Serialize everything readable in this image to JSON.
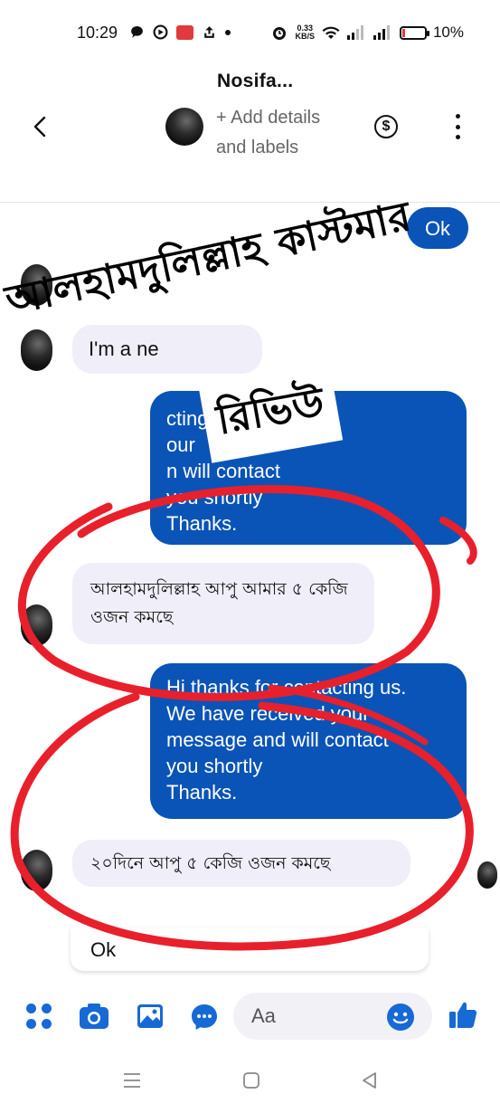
{
  "status_bar": {
    "time": "10:29",
    "net_speed_value": "0.33",
    "net_speed_unit": "KB/S",
    "battery": "10%"
  },
  "header": {
    "name": "Nosifa...",
    "subtitle": "+ Add details and labels",
    "payment_symbol": "$"
  },
  "messages": {
    "ok_out": "Ok",
    "incoming_1": "I'm a ne",
    "outgoing_1": "cting us.\nour\nn                 will contact\nyou shortly\nThanks.",
    "incoming_2": "আলহামদুলিল্লাহ আপু আমার ৫ কেজি ওজন কমছে",
    "outgoing_2": "Hi thanks for contacting us.\nWe have received your\nmessage and will contact\nyou shortly\nThanks.",
    "incoming_3": "২০দিনে আপু ৫ কেজি ওজন কমছে",
    "ok_in": "Ok"
  },
  "overlay": {
    "line1": "আলহামদুলিল্লাহ কাস্টমার",
    "line2": "রিভিউ"
  },
  "composer": {
    "placeholder": "Aa"
  },
  "colors": {
    "brand_blue": "#0a54b8",
    "icon_blue": "#1769d6",
    "annotation_red": "#e8202c"
  },
  "icons": [
    "back-arrow-icon",
    "dollar-circle-icon",
    "more-vertical-icon",
    "apps-grid-icon",
    "camera-icon",
    "gallery-icon",
    "chat-bubble-icon",
    "emoji-icon",
    "thumbs-up-icon",
    "recents-icon",
    "home-icon",
    "back-nav-icon"
  ]
}
